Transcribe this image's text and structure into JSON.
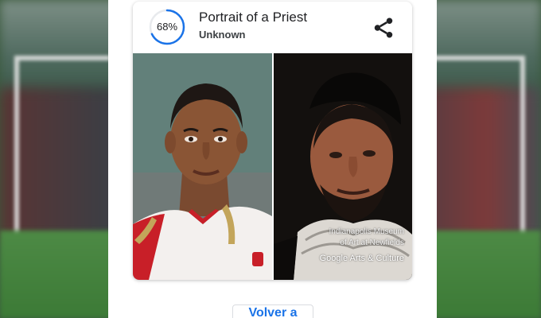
{
  "match": {
    "score_text": "68%",
    "score_fraction": 0.68,
    "title": "Portrait of a Priest",
    "artist": "Unknown"
  },
  "artwork": {
    "museum_line1": "Indianapolis Museum",
    "museum_line2": "of Art at Newfields",
    "brand": "Google Arts & Culture"
  },
  "actions": {
    "back_label": "Volver a"
  },
  "colors": {
    "accent": "#1a73e8",
    "ring_track": "#e8eaed"
  }
}
